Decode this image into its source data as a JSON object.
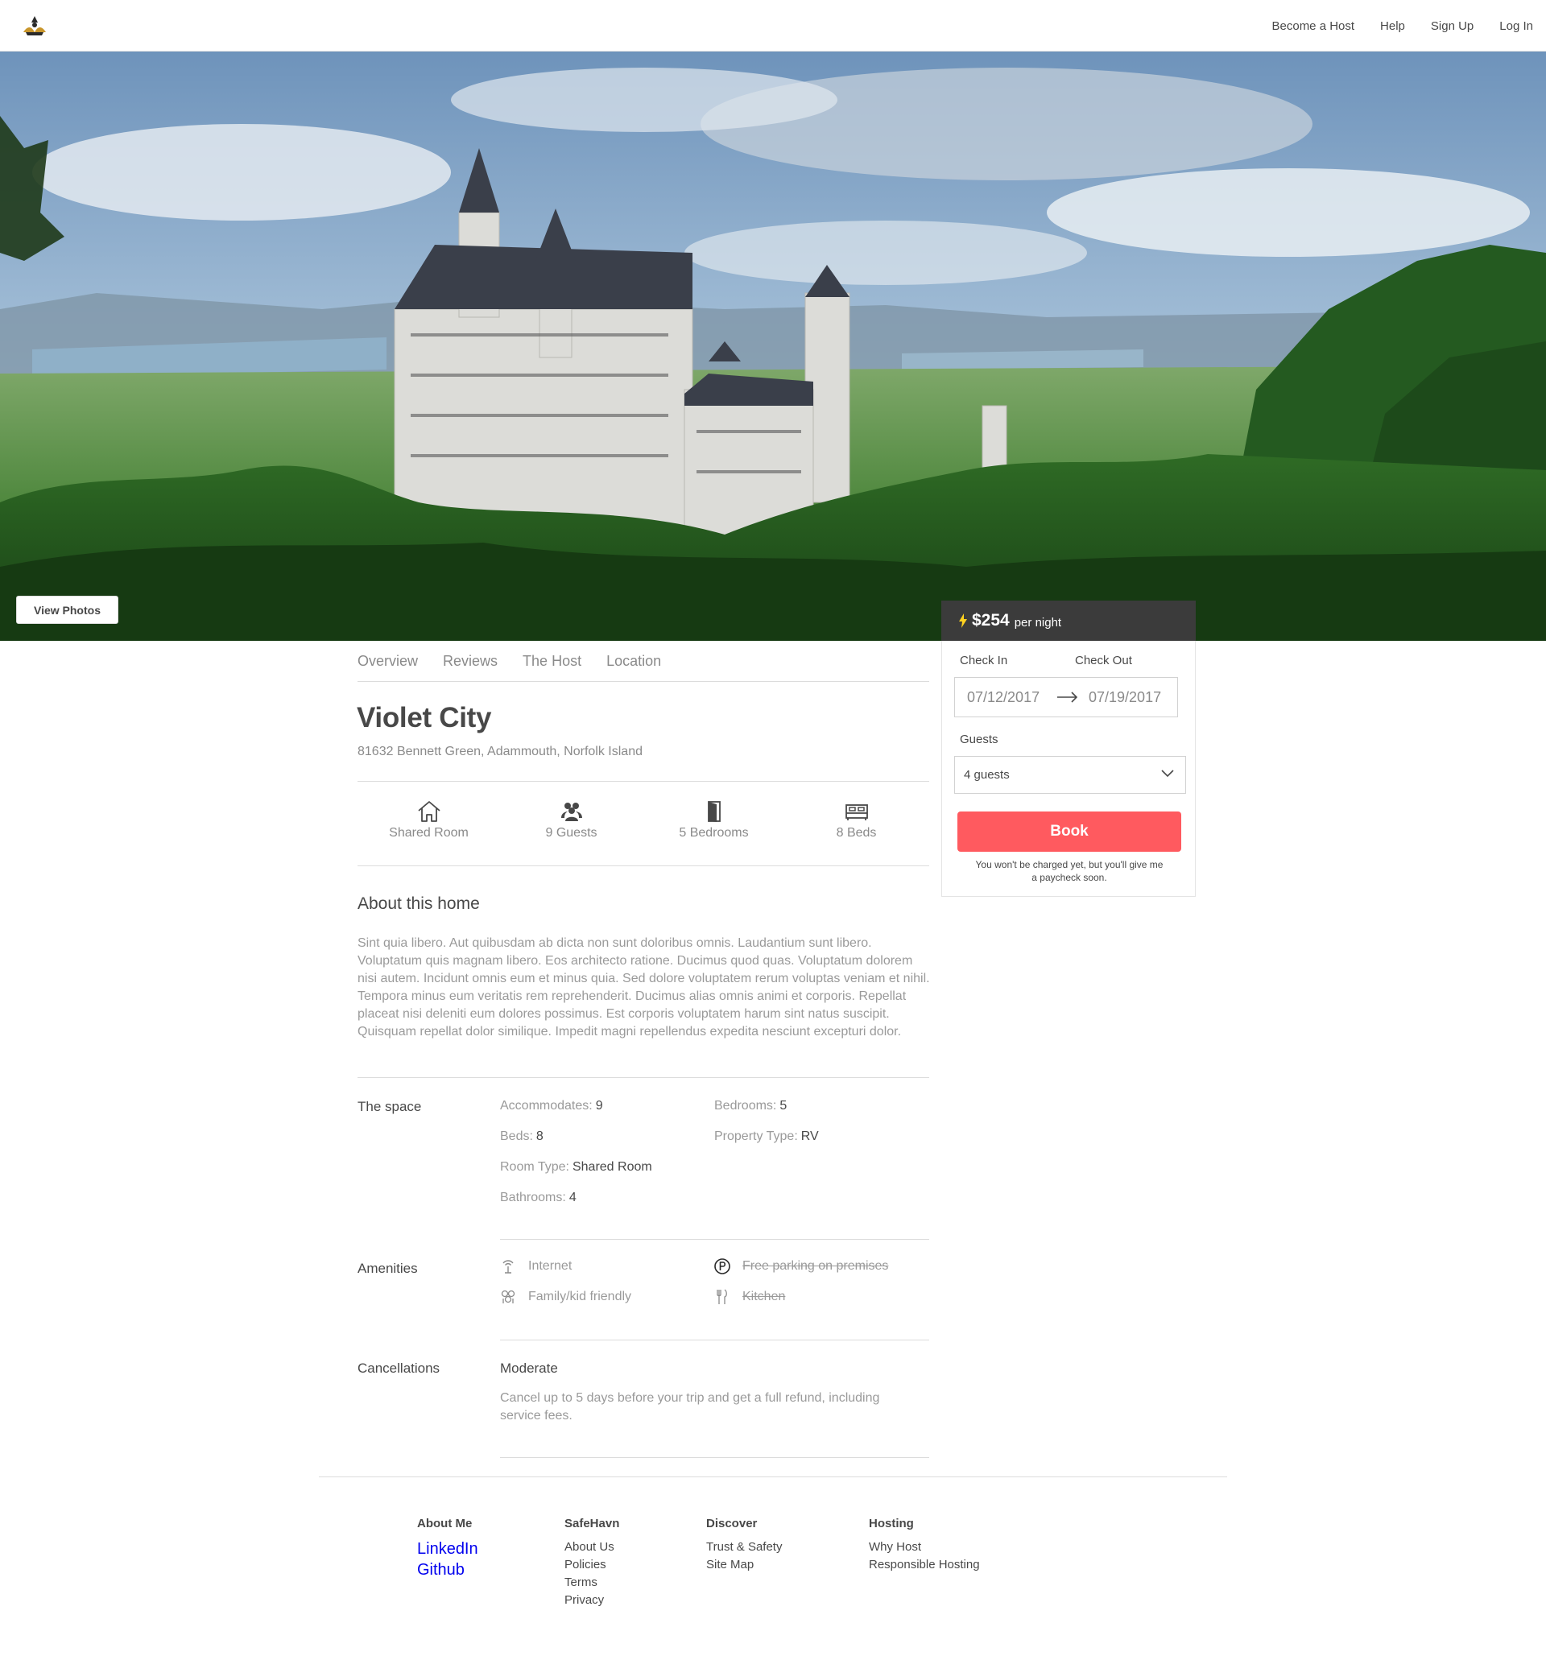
{
  "nav": {
    "links": [
      "Become a Host",
      "Help",
      "Sign Up",
      "Log In"
    ]
  },
  "hero": {
    "view_photos_label": "View Photos"
  },
  "booking": {
    "price": "$254",
    "price_unit": "per night",
    "check_in_label": "Check In",
    "check_out_label": "Check Out",
    "check_in_value": "07/12/2017",
    "check_out_value": "07/19/2017",
    "guests_label": "Guests",
    "guests_value": "4 guests",
    "book_label": "Book",
    "note": "You won't be charged yet, but you'll give me a paycheck soon."
  },
  "tabs": [
    "Overview",
    "Reviews",
    "The Host",
    "Location"
  ],
  "listing": {
    "title": "Violet City",
    "address": "81632 Bennett Green, Adammouth, Norfolk Island"
  },
  "features": [
    {
      "icon": "house-icon",
      "label": "Shared Room"
    },
    {
      "icon": "guests-icon",
      "label": "9 Guests"
    },
    {
      "icon": "door-icon",
      "label": "5 Bedrooms"
    },
    {
      "icon": "bed-icon",
      "label": "8 Beds"
    }
  ],
  "about": {
    "heading": "About this home",
    "text": "Sint quia libero. Aut quibusdam ab dicta non sunt doloribus omnis. Laudantium sunt libero. Voluptatum quis magnam libero. Eos architecto ratione. Ducimus quod quas. Voluptatum dolorem nisi autem. Incidunt omnis eum et minus quia. Sed dolore voluptatem rerum voluptas veniam et nihil. Tempora minus eum veritatis rem reprehenderit. Ducimus alias omnis animi et corporis. Repellat placeat nisi deleniti eum dolores possimus. Est corporis voluptatem harum sint natus suscipit. Quisquam repellat dolor similique. Impedit magni repellendus expedita nesciunt excepturi dolor."
  },
  "space": {
    "label": "The space",
    "accommodates_label": "Accommodates:",
    "accommodates": "9",
    "bedrooms_label": "Bedrooms:",
    "bedrooms": "5",
    "beds_label": "Beds:",
    "beds": "8",
    "property_type_label": "Property Type:",
    "property_type": "RV",
    "room_type_label": "Room Type:",
    "room_type": "Shared Room",
    "bathrooms_label": "Bathrooms:",
    "bathrooms": "4"
  },
  "amenities": {
    "label": "Amenities",
    "items": [
      {
        "icon": "wifi-icon",
        "label": "Internet",
        "available": true
      },
      {
        "icon": "parking-icon",
        "label": "Free parking on premises",
        "available": false
      },
      {
        "icon": "family-icon",
        "label": "Family/kid friendly",
        "available": true
      },
      {
        "icon": "kitchen-icon",
        "label": "Kitchen",
        "available": false
      }
    ]
  },
  "cancellations": {
    "label": "Cancellations",
    "type": "Moderate",
    "text": "Cancel up to 5 days before your trip and get a full refund, including service fees."
  },
  "footer": {
    "columns": [
      {
        "heading": "About Me",
        "links": [
          "LinkedIn",
          "Github"
        ]
      },
      {
        "heading": "SafeHavn",
        "links": [
          "About Us",
          "Policies",
          "Terms",
          "Privacy"
        ]
      },
      {
        "heading": "Discover",
        "links": [
          "Trust & Safety",
          "Site Map"
        ]
      },
      {
        "heading": "Hosting",
        "links": [
          "Why Host",
          "Responsible Hosting"
        ]
      }
    ]
  },
  "colors": {
    "accent": "#ff5a5f",
    "text": "#484848",
    "muted": "#9a9a9a",
    "price_bar": "#3b3b3b",
    "bolt": "#ffd21f",
    "link": "#0000ee"
  }
}
